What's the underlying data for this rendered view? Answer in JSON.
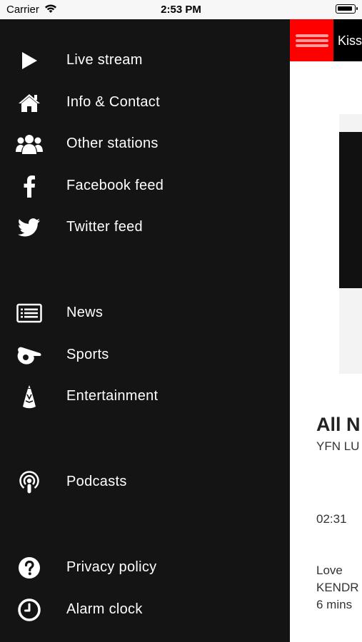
{
  "status_bar": {
    "carrier": "Carrier",
    "time": "2:53 PM"
  },
  "header": {
    "station_title": "Kiss"
  },
  "now_playing": {
    "title": "All N",
    "artist": "YFN LU",
    "duration": "02:31"
  },
  "recent": {
    "title": "Love",
    "artist": "KENDR",
    "time_ago": "6 mins"
  },
  "drawer": {
    "items": [
      {
        "label": "Live stream",
        "icon": "play-icon"
      },
      {
        "label": "Info & Contact",
        "icon": "home-icon"
      },
      {
        "label": "Other stations",
        "icon": "users-icon"
      },
      {
        "label": "Facebook feed",
        "icon": "facebook-icon"
      },
      {
        "label": "Twitter feed",
        "icon": "twitter-icon"
      },
      {
        "label": "News",
        "icon": "newspaper-icon"
      },
      {
        "label": "Sports",
        "icon": "whistle-icon"
      },
      {
        "label": "Entertainment",
        "icon": "entertainment-icon"
      },
      {
        "label": "Podcasts",
        "icon": "podcast-icon"
      },
      {
        "label": "Privacy policy",
        "icon": "question-icon"
      },
      {
        "label": "Alarm clock",
        "icon": "clock-icon"
      }
    ]
  },
  "colors": {
    "drawer_bg": "#141414",
    "accent": "#ff0000",
    "text": "#ffffff"
  }
}
